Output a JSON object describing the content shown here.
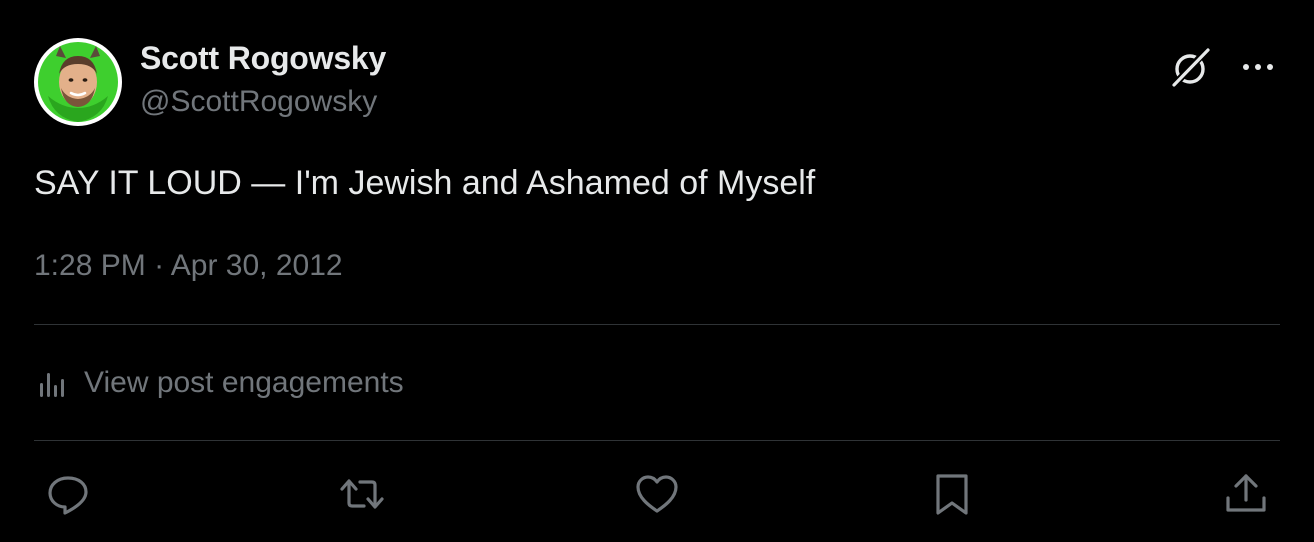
{
  "author": {
    "display_name": "Scott Rogowsky",
    "handle": "@ScottRogowsky",
    "avatar_icon": "avatar-photo"
  },
  "header_actions": {
    "grok_icon": "grok-icon",
    "more_icon": "more-horizontal-icon"
  },
  "post": {
    "text": "SAY IT LOUD — I'm Jewish and Ashamed of Myself",
    "time": "1:28 PM",
    "separator": "·",
    "date": "Apr 30, 2012"
  },
  "engagements": {
    "label": "View post engagements",
    "icon": "analytics-icon"
  },
  "actions": [
    {
      "name": "reply",
      "icon": "reply-icon"
    },
    {
      "name": "repost",
      "icon": "repost-icon"
    },
    {
      "name": "like",
      "icon": "heart-icon"
    },
    {
      "name": "bookmark",
      "icon": "bookmark-icon"
    },
    {
      "name": "share",
      "icon": "share-icon"
    }
  ],
  "colors": {
    "background": "#000000",
    "primary_text": "#e7e9ea",
    "secondary_text": "#71767b",
    "divider": "#2f3336",
    "avatar_accent": "#3ecf2e"
  }
}
